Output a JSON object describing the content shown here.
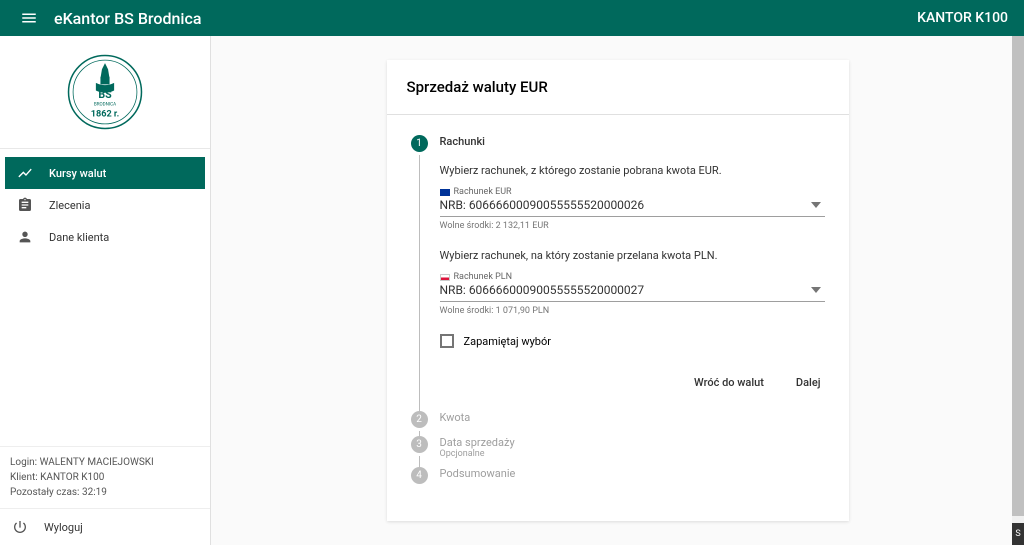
{
  "header": {
    "title": "eKantor BS Brodnica",
    "right": "KANTOR K100"
  },
  "logo": {
    "top": "BS",
    "mid": "BRODNICA",
    "bottom": "1862 r."
  },
  "nav": {
    "items": [
      {
        "label": "Kursy walut"
      },
      {
        "label": "Zlecenia"
      },
      {
        "label": "Dane klienta"
      }
    ]
  },
  "footer": {
    "login_label": "Login:",
    "login_value": "WALENTY MACIEJOWSKI",
    "client_label": "Klient:",
    "client_value": "KANTOR K100",
    "time_label": "Pozostały czas:",
    "time_value": "32:19",
    "logout": "Wyloguj"
  },
  "panel": {
    "title": "Sprzedaż waluty EUR",
    "steps": [
      {
        "title": "Rachunki"
      },
      {
        "title": "Kwota"
      },
      {
        "title": "Data sprzedaży",
        "sub": "Opcjonalne"
      },
      {
        "title": "Podsumowanie"
      }
    ],
    "from": {
      "prompt": "Wybierz rachunek, z którego zostanie pobrana kwota EUR.",
      "caption": "Rachunek EUR",
      "value": "NRB: 60666600090055555520000026",
      "helper": "Wolne środki: 2 132,11 EUR"
    },
    "to": {
      "prompt": "Wybierz rachunek, na który zostanie przelana kwota PLN.",
      "caption": "Rachunek PLN",
      "value": "NRB: 60666600090055555520000027",
      "helper": "Wolne środki: 1 071,90 PLN"
    },
    "remember": "Zapamiętaj wybór",
    "back": "Wróć do walut",
    "next": "Dalej"
  }
}
